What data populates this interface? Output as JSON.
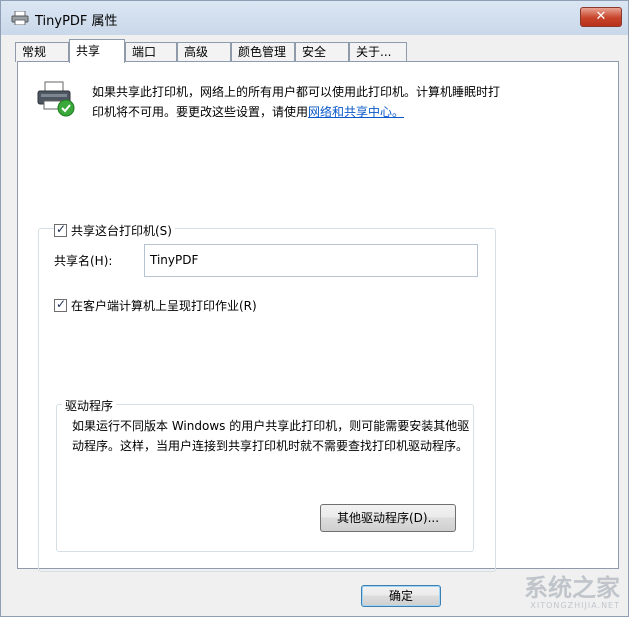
{
  "window": {
    "title": "TinyPDF 属性",
    "close_label": "✕"
  },
  "tabs": [
    {
      "label": "常规"
    },
    {
      "label": "共享"
    },
    {
      "label": "端口"
    },
    {
      "label": "高级"
    },
    {
      "label": "颜色管理"
    },
    {
      "label": "安全"
    },
    {
      "label": "关于..."
    }
  ],
  "active_tab": "共享",
  "sharing": {
    "info_text": "如果共享此打印机，网络上的所有用户都可以使用此打印机。计算机睡眠时打印机将不可用。要更改这些设置，请使用",
    "info_link": "网络和共享中心。",
    "share_checkbox_label": "共享这台打印机(S)",
    "share_checked": true,
    "share_name_label": "共享名(H):",
    "share_name_value": "TinyPDF",
    "render_checkbox_label": "在客户端计算机上呈现打印作业(R)",
    "render_checked": true
  },
  "drivers": {
    "legend": "驱动程序",
    "description": "如果运行不同版本 Windows 的用户共享此打印机，则可能需要安装其他驱动程序。这样，当用户连接到共享打印机时就不需要查找打印机驱动程序。",
    "button_label": "其他驱动程序(D)..."
  },
  "footer": {
    "ok_label": "确定"
  },
  "watermark": {
    "main": "系统之家",
    "sub": "XITONGZHIJIA.NET"
  },
  "icons": {
    "title": "printer-icon",
    "sharing": "printer-shared-icon"
  }
}
